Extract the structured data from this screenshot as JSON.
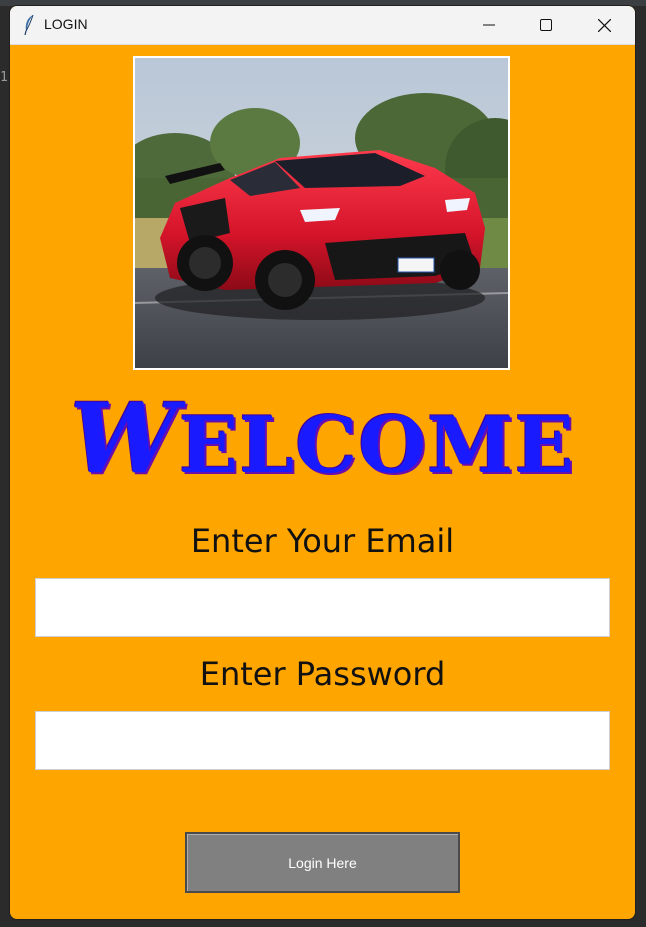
{
  "window": {
    "title": "LOGIN",
    "icon": "feather-icon",
    "controls": [
      "minimize-icon",
      "maximize-icon",
      "close-icon"
    ]
  },
  "hero_image": "red sports car on track",
  "welcome": {
    "first": "W",
    "rest": "ELCOME"
  },
  "form": {
    "email_label": "Enter Your Email",
    "email_value": "",
    "password_label": "Enter Password",
    "password_value": "",
    "submit_label": "Login Here"
  },
  "background": {
    "line_number": "1"
  },
  "colors": {
    "window_bg": "#FFA500",
    "welcome_text": "#1a1aff",
    "button_bg": "#808080",
    "button_text": "#ffffff"
  }
}
